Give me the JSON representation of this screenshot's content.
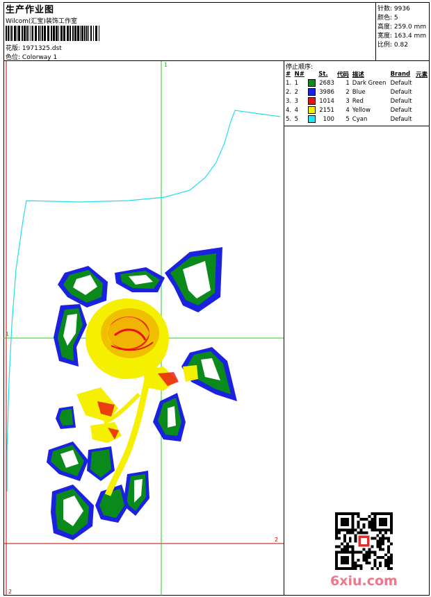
{
  "header": {
    "title": "生产作业图",
    "company": "Wilcom(汇宝)装饰工作室",
    "design_label": "花版:",
    "design_value": "1971325.dst",
    "colorway_label": "色位:",
    "colorway_value": "Colorway 1"
  },
  "specs": [
    {
      "label": "针数:",
      "value": "9936"
    },
    {
      "label": "颜色:",
      "value": "5"
    },
    {
      "label": "高度:",
      "value": "259.0 mm"
    },
    {
      "label": "宽度:",
      "value": "163.4 mm"
    },
    {
      "label": "比例:",
      "value": "0.82"
    }
  ],
  "stop_sequence": {
    "title": "停止顺序:",
    "columns": [
      "#",
      "N#",
      "St.",
      "代码",
      "描述",
      "Brand",
      "元素"
    ],
    "rows": [
      {
        "idx": "1.",
        "n": "1",
        "swatch": "#0a8a1a",
        "st": "2683",
        "code": "1",
        "desc": "Dark Green",
        "brand": "Default"
      },
      {
        "idx": "2.",
        "n": "2",
        "swatch": "#1a22e0",
        "st": "3986",
        "code": "2",
        "desc": "Blue",
        "brand": "Default"
      },
      {
        "idx": "3.",
        "n": "3",
        "swatch": "#e81010",
        "st": "1014",
        "code": "3",
        "desc": "Red",
        "brand": "Default"
      },
      {
        "idx": "4.",
        "n": "4",
        "swatch": "#f4f000",
        "st": "2151",
        "code": "4",
        "desc": "Yellow",
        "brand": "Default"
      },
      {
        "idx": "5.",
        "n": "5",
        "swatch": "#24e4f0",
        "st": "100",
        "code": "5",
        "desc": "Cyan",
        "brand": "Default"
      }
    ]
  },
  "axes": {
    "green_label": "1",
    "red_label": "2"
  },
  "watermark": "6xiu.com",
  "colors": {
    "guide_green": "#22cc22",
    "guide_red": "#cc0000",
    "outline_cyan": "#22dde8",
    "thread_blue": "#1a22e0",
    "thread_green": "#0a8a1a",
    "thread_yellow": "#f4f000",
    "thread_red": "#e81010"
  }
}
